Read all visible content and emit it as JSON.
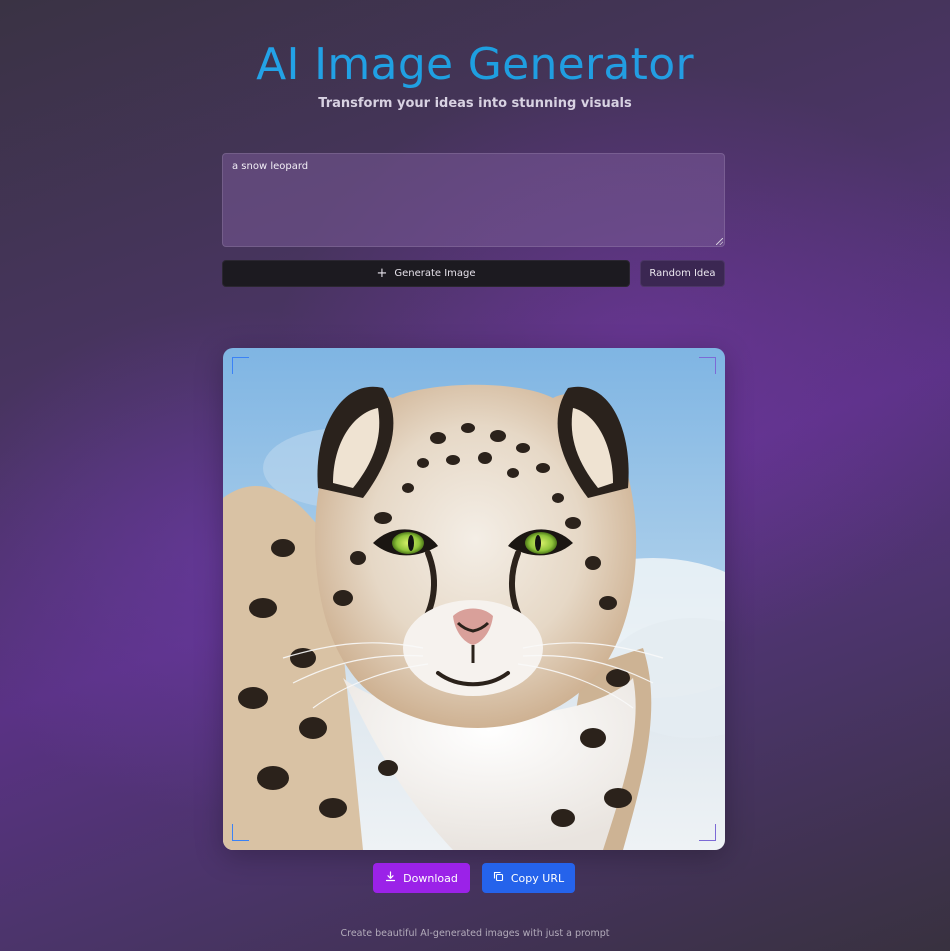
{
  "header": {
    "title": "AI Image Generator",
    "subtitle": "Transform your ideas into stunning visuals"
  },
  "prompt": {
    "value": "a snow leopard"
  },
  "actions": {
    "generate_label": "Generate Image",
    "random_label": "Random Idea"
  },
  "result": {
    "image_subject": "snow leopard portrait",
    "download_label": "Download",
    "copy_label": "Copy URL"
  },
  "footer": {
    "text": "Create beautiful AI-generated images with just a prompt"
  },
  "icons": {
    "generate": "plus-icon",
    "download": "download-icon",
    "copy": "copy-icon"
  },
  "colors": {
    "title": "#1ea8e8",
    "generate_button": "#1c1a20",
    "random_button": "#3b2752",
    "download_button": "#9b22e8",
    "copy_button": "#2563eb"
  }
}
